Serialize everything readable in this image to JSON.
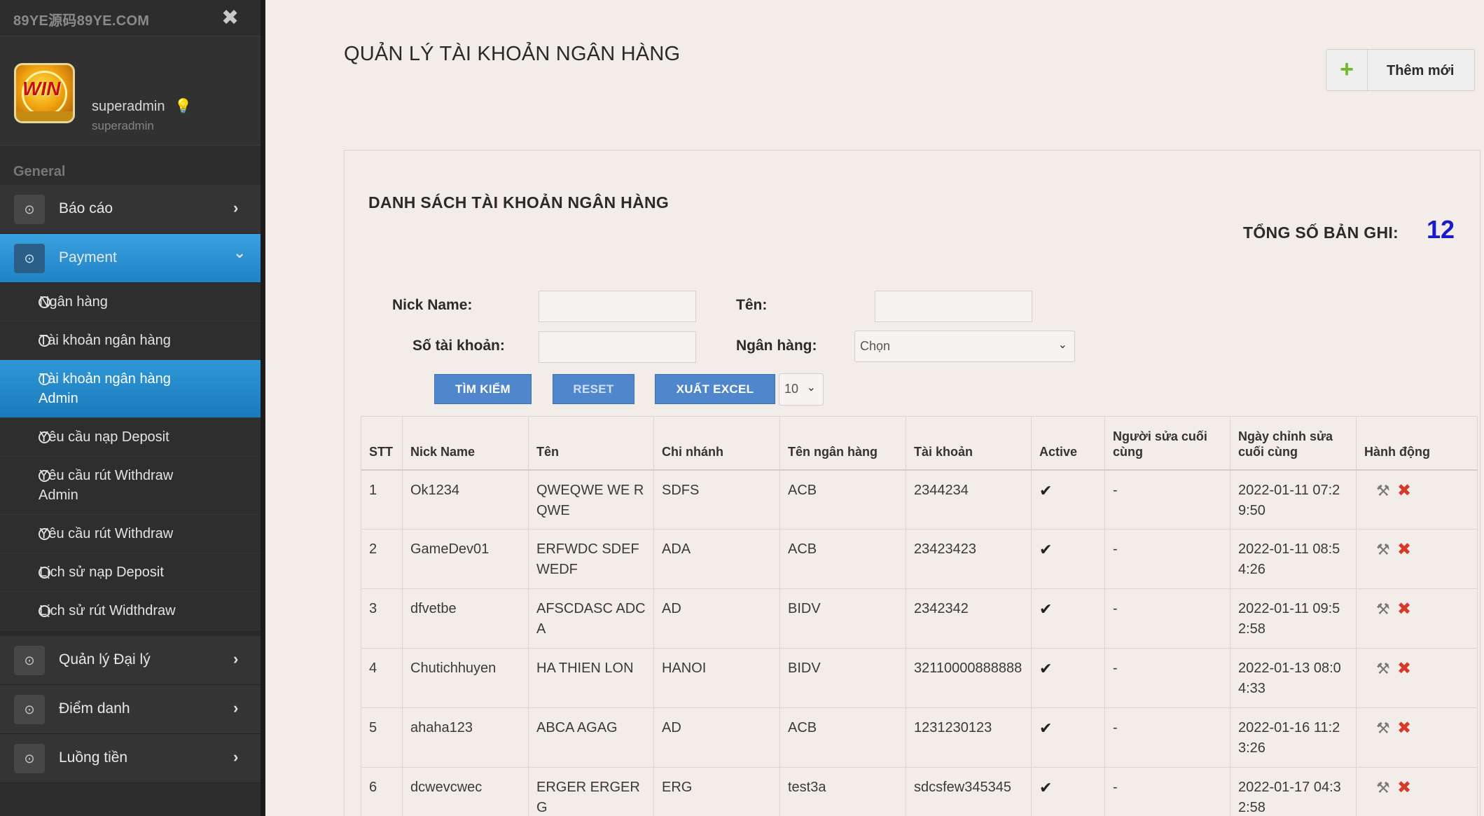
{
  "sidebar": {
    "brand": "89YE源码89YE.COM",
    "close_icon": "✖",
    "user": {
      "name": "superadmin",
      "role": "superadmin",
      "key_icon": "💡"
    },
    "section": "General",
    "menu": [
      {
        "label": "Báo cáo",
        "icon": "gamepad-icon",
        "caret": "›"
      },
      {
        "label": "Payment",
        "icon": "gamepad-icon",
        "caret": "⌄"
      }
    ],
    "sub_items": [
      {
        "l1": "Ngân hàng",
        "l2": ""
      },
      {
        "l1": "Tài khoản ngân hàng",
        "l2": ""
      },
      {
        "l1": "Tài khoản ngân hàng",
        "l2": "Admin"
      },
      {
        "l1": "Yêu cầu nạp Deposit",
        "l2": ""
      },
      {
        "l1": "Yêu cầu rút Withdraw",
        "l2": "Admin"
      },
      {
        "l1": "Yêu cầu rút Withdraw",
        "l2": ""
      },
      {
        "l1": "Lịch sử nạp Deposit",
        "l2": ""
      },
      {
        "l1": "Lịch sử rút Widthdraw",
        "l2": ""
      }
    ],
    "menu_bottom": [
      {
        "label": "Quản lý Đại lý",
        "icon": "gamepad-icon",
        "caret": "›"
      },
      {
        "label": "Điểm danh",
        "icon": "gamepad-icon",
        "caret": "›"
      },
      {
        "label": "Luồng tiền",
        "icon": "gamepad-icon",
        "caret": "›"
      }
    ]
  },
  "header": {
    "title": "QUẢN LÝ TÀI KHOẢN NGÂN HÀNG",
    "add_label": "Thêm mới",
    "add_icon": "+"
  },
  "panel": {
    "title": "DANH SÁCH TÀI KHOẢN NGÂN HÀNG",
    "total_label": "TỔNG SỐ BẢN GHI:",
    "total_value": "12"
  },
  "filters": {
    "nick_label": "Nick Name:",
    "ten_label": "Tên:",
    "stk_label": "Số tài khoản:",
    "bank_label": "Ngân hàng:",
    "bank_selected": "Chọn",
    "search_btn": "TÌM KIẾM",
    "reset_btn": "RESET",
    "excel_btn": "XUẤT EXCEL",
    "page_size": "10"
  },
  "table": {
    "headers": {
      "stt": "STT",
      "nick": "Nick Name",
      "ten": "Tên",
      "branch": "Chi nhánh",
      "bank": "Tên ngân hàng",
      "acct": "Tài khoản",
      "active": "Active",
      "editor": "Người sửa cuối cùng",
      "edited": "Ngày chỉnh sửa cuối cùng",
      "action": "Hành động"
    },
    "rows": [
      {
        "stt": "1",
        "nick": "Ok1234",
        "ten": "QWEQWE WE RQWE",
        "branch": "SDFS",
        "bank": "ACB",
        "acct": "2344234",
        "active": "✔",
        "editor": "-",
        "edited": "2022-01-11 07:29:50"
      },
      {
        "stt": "2",
        "nick": "GameDev01",
        "ten": "ERFWDC SDEF WEDF",
        "branch": "ADA",
        "bank": "ACB",
        "acct": "23423423",
        "active": "✔",
        "editor": "-",
        "edited": "2022-01-11 08:54:26"
      },
      {
        "stt": "3",
        "nick": "dfvetbe",
        "ten": "AFSCDASC ADCA",
        "branch": "AD",
        "bank": "BIDV",
        "acct": "2342342",
        "active": "✔",
        "editor": "-",
        "edited": "2022-01-11 09:52:58"
      },
      {
        "stt": "4",
        "nick": "Chutichhuyen",
        "ten": "HA THIEN LON",
        "branch": "HANOI",
        "bank": "BIDV",
        "acct": "32110000888888",
        "active": "✔",
        "editor": "-",
        "edited": "2022-01-13 08:04:33"
      },
      {
        "stt": "5",
        "nick": "ahaha123",
        "ten": "ABCA AGAG",
        "branch": "AD",
        "bank": "ACB",
        "acct": "1231230123",
        "active": "✔",
        "editor": "-",
        "edited": "2022-01-16 11:23:26"
      },
      {
        "stt": "6",
        "nick": "dcwevcwec",
        "ten": "ERGER ERGERG",
        "branch": "ERG",
        "bank": "test3a",
        "acct": "sdcsfew345345",
        "active": "✔",
        "editor": "-",
        "edited": "2022-01-17 04:32:58"
      }
    ]
  },
  "icons": {
    "edit": "⚒",
    "delete": "✖",
    "chevron": "⌄"
  }
}
